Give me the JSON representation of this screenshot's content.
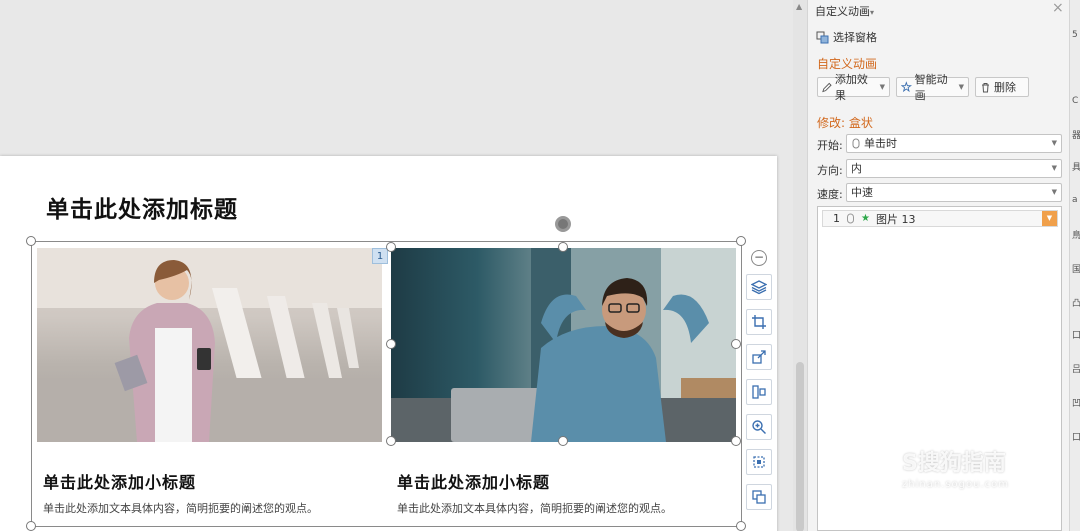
{
  "slide": {
    "title": "单击此处添加标题",
    "anim_order": "1",
    "columns": [
      {
        "subtitle": "单击此处添加小标题",
        "body": "单击此处添加文本具体内容，简明扼要的阐述您的观点。"
      },
      {
        "subtitle": "单击此处添加小标题",
        "body": "单击此处添加文本具体内容，简明扼要的阐述您的观点。"
      }
    ]
  },
  "float_tools": {
    "collapse": "−",
    "icons": [
      "layers-icon",
      "crop-icon",
      "transform-icon",
      "align-icon",
      "zoom-icon",
      "fit-icon",
      "copy-icon"
    ]
  },
  "panel": {
    "header": "自定义动画",
    "header_caret": "▾",
    "close": "×",
    "selection_pane": "选择窗格",
    "section_custom": "自定义动画",
    "add_effect": "添加效果",
    "smart_anim": "智能动画",
    "delete": "删除",
    "modify": "修改: 盒状",
    "start_label": "开始:",
    "start_value": "单击时",
    "direction_label": "方向:",
    "direction_value": "内",
    "speed_label": "速度:",
    "speed_value": "中速",
    "list": [
      {
        "index": "1",
        "name": "图片 13"
      }
    ]
  },
  "strip": {
    "glyphs": [
      "5",
      "C",
      "器",
      "具",
      "a",
      "鳥",
      "国",
      "凸",
      "口",
      "吕",
      "凹",
      "口"
    ]
  },
  "watermark": {
    "logo": "S搜狗指南",
    "url": "zhinan.sogou.com"
  },
  "colors": {
    "accent_orange": "#d2691e",
    "tool_blue": "#3b6fb0",
    "list_dropdown": "#f0a04b",
    "star_green": "#2ea84a"
  }
}
